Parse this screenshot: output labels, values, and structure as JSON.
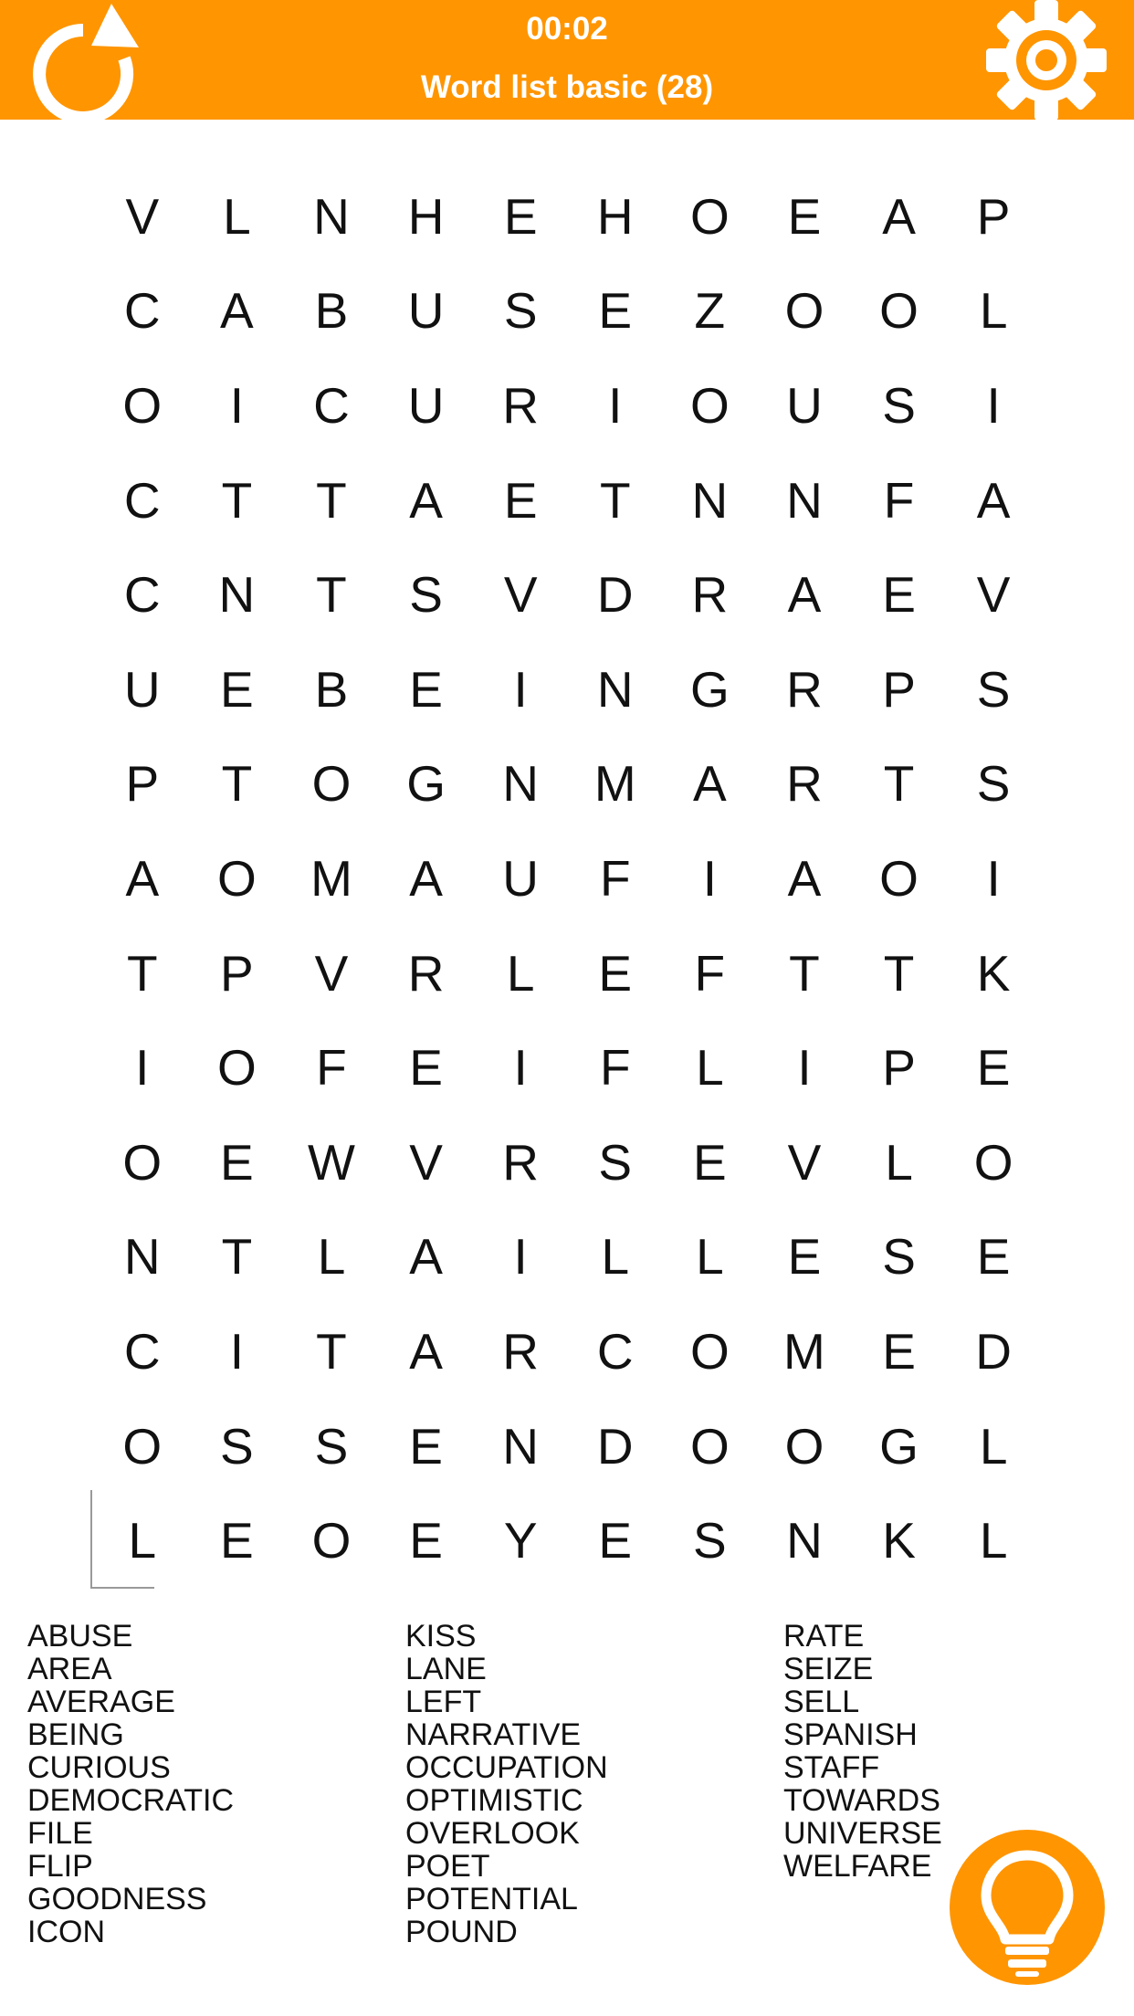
{
  "header": {
    "timer": "00:02",
    "title": "Word list basic (28)",
    "background_color": "#ff9500",
    "restart_icon": "restart-icon",
    "settings_icon": "gear-icon"
  },
  "grid": {
    "rows": [
      "VLNHEHOEAP",
      "CABUSEZOOL",
      "OICURIOUSI",
      "CTTAETNNFA",
      "CNTSVDRAEV",
      "UEBEINGRPS",
      "PTOGNMARTS",
      "AOMAUFIAOI",
      "TPVRLEFTTK",
      "IOFEIFLIPE",
      "OEWVRSEVLO",
      "NTLAILLESE",
      "CITARCOMED",
      "OSSENDOOGL",
      "LEOEYESNKL"
    ]
  },
  "words": {
    "col1": [
      "ABUSE",
      "AREA",
      "AVERAGE",
      "BEING",
      "CURIOUS",
      "DEMOCRATIC",
      "FILE",
      "FLIP",
      "GOODNESS",
      "ICON"
    ],
    "col2": [
      "KISS",
      "LANE",
      "LEFT",
      "NARRATIVE",
      "OCCUPATION",
      "OPTIMISTIC",
      "OVERLOOK",
      "POET",
      "POTENTIAL",
      "POUND"
    ],
    "col3": [
      "RATE",
      "SEIZE",
      "SELL",
      "SPANISH",
      "STAFF",
      "TOWARDS",
      "UNIVERSE",
      "WELFARE"
    ]
  },
  "hint": {
    "icon": "lightbulb-icon",
    "color": "#ff9500"
  }
}
